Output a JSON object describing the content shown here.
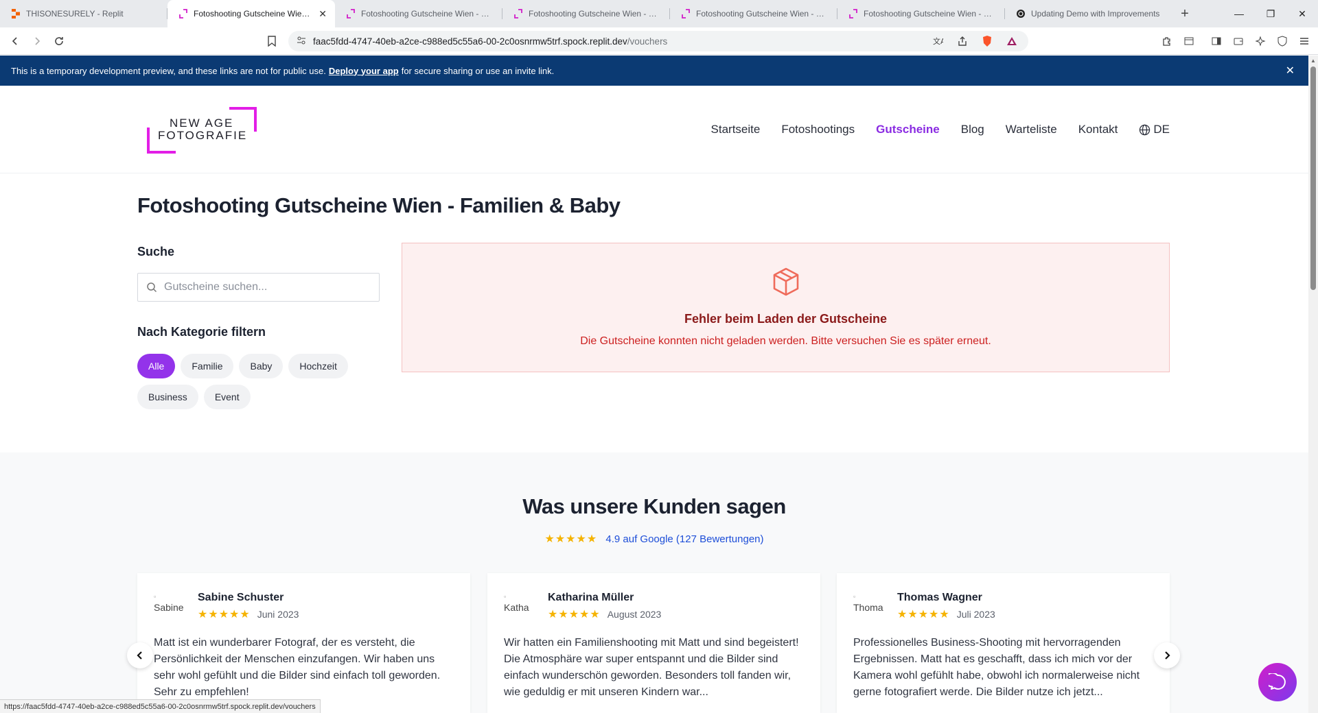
{
  "browser": {
    "tabs": [
      {
        "title": "THISONESURELY - Replit",
        "icon": "replit-icon",
        "active": false
      },
      {
        "title": "Fotoshooting Gutscheine Wien - Ge",
        "icon": "site-favicon",
        "active": true
      },
      {
        "title": "Fotoshooting Gutscheine Wien - Ges",
        "icon": "site-favicon",
        "active": false
      },
      {
        "title": "Fotoshooting Gutscheine Wien - Ges",
        "icon": "site-favicon",
        "active": false
      },
      {
        "title": "Fotoshooting Gutscheine Wien - Ges",
        "icon": "site-favicon",
        "active": false
      },
      {
        "title": "Fotoshooting Gutscheine Wien - Ges",
        "icon": "site-favicon",
        "active": false
      },
      {
        "title": "Updating Demo with Improvements",
        "icon": "openai-icon",
        "active": false
      }
    ],
    "url_host": "faac5fdd-4747-40eb-a2ce-c988ed5c55a6-00-2c0osnrmw5trf.spock.replit.dev",
    "url_path": "/vouchers",
    "status_url": "https://faac5fdd-4747-40eb-a2ce-c988ed5c55a6-00-2c0osnrmw5trf.spock.replit.dev/vouchers"
  },
  "banner": {
    "text_before": "This is a temporary development preview, and these links are not for public use.",
    "link": "Deploy your app",
    "text_after": "for secure sharing or use an invite link."
  },
  "logo": {
    "line1": "NEW AGE",
    "line2": "FOTOGRAFIE",
    "accent": "#e21ee6"
  },
  "nav": {
    "items": [
      "Startseite",
      "Fotoshootings",
      "Gutscheine",
      "Blog",
      "Warteliste",
      "Kontakt"
    ],
    "active": "Gutscheine",
    "language": "DE"
  },
  "page": {
    "title": "Fotoshooting Gutscheine Wien - Familien & Baby",
    "search_heading": "Suche",
    "search_placeholder": "Gutscheine suchen...",
    "filter_heading": "Nach Kategorie filtern",
    "categories": [
      "Alle",
      "Familie",
      "Baby",
      "Hochzeit",
      "Business",
      "Event"
    ],
    "active_category": "Alle"
  },
  "error": {
    "title": "Fehler beim Laden der Gutscheine",
    "message": "Die Gutscheine konnten nicht geladen werden. Bitte versuchen Sie es später erneut."
  },
  "reviews": {
    "title": "Was unsere Kunden sagen",
    "rating_stars": "★★★★★",
    "rating_text": "4.9 auf Google (127 Bewertungen)",
    "items": [
      {
        "avatar_alt": "Sabine",
        "name": "Sabine Schuster",
        "stars": "★★★★★",
        "date": "Juni 2023",
        "text": "Matt ist ein wunderbarer Fotograf, der es versteht, die Persönlichkeit der Menschen einzufangen. Wir haben uns sehr wohl gefühlt und die Bilder sind einfach toll geworden. Sehr zu empfehlen!"
      },
      {
        "avatar_alt": "Katha",
        "name": "Katharina Müller",
        "stars": "★★★★★",
        "date": "August 2023",
        "text": "Wir hatten ein Familienshooting mit Matt und sind begeistert! Die Atmosphäre war super entspannt und die Bilder sind einfach wunderschön geworden. Besonders toll fanden wir, wie geduldig er mit unseren Kindern war..."
      },
      {
        "avatar_alt": "Thoma",
        "name": "Thomas Wagner",
        "stars": "★★★★★",
        "date": "Juli 2023",
        "text": "Professionelles Business-Shooting mit hervorragenden Ergebnissen. Matt hat es geschafft, dass ich mich vor der Kamera wohl gefühlt habe, obwohl ich normalerweise nicht gerne fotografiert werde. Die Bilder nutze ich jetzt..."
      }
    ]
  },
  "colors": {
    "primary": "#9333ea",
    "banner": "#0b3a73",
    "error_text": "#cc1f1f",
    "star": "#f5b301"
  }
}
